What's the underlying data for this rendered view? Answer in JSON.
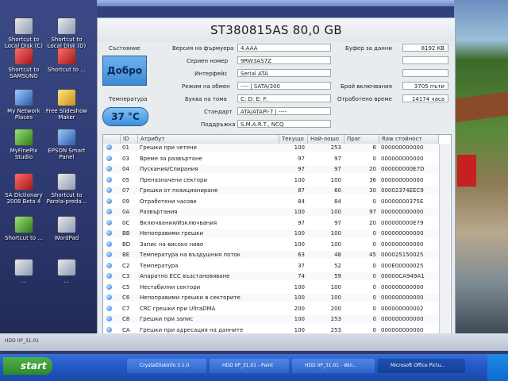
{
  "window": {
    "title": "ST380815AS 80,0 GB"
  },
  "status": {
    "label": "Състояние",
    "value": "Добро"
  },
  "temperature": {
    "label": "Температура",
    "value": "37 °C"
  },
  "info": {
    "firmware_label": "Версия на фърмуера",
    "firmware": "4.AAA",
    "serial_label": "Сериен номер",
    "serial": "9RW3AS7Z",
    "interface_label": "Интерфейс",
    "interface": "Serial ATA",
    "transfer_label": "Режим на обмен",
    "transfer": "---- | SATA/300",
    "volume_label": "Буква на тома",
    "volume": "C: D: E: F:",
    "standard_label": "Стандарт",
    "standard": "ATA/ATAPI-7 | ----",
    "features_label": "Поддръжка",
    "features": "S.M.A.R.T., NCQ",
    "buffer_label": "Буфер за данни",
    "buffer": "8192 KB",
    "power_count_label": "Брой включвания",
    "power_count": "3705 пъти",
    "power_hours_label": "Отработено време",
    "power_hours": "14174 часа"
  },
  "table": {
    "headers": [
      "ID",
      "Атрибут",
      "Текущо",
      "Най-лошо",
      "Праг",
      "Raw стойност"
    ],
    "rows": [
      {
        "id": "01",
        "name": "Грешки при четене",
        "cur": "100",
        "worst": "253",
        "thr": "6",
        "raw": "000000000000"
      },
      {
        "id": "03",
        "name": "Време за развъртане",
        "cur": "97",
        "worst": "97",
        "thr": "0",
        "raw": "000000000000"
      },
      {
        "id": "04",
        "name": "Пускания/Спирания",
        "cur": "97",
        "worst": "97",
        "thr": "20",
        "raw": "000000000E7D"
      },
      {
        "id": "05",
        "name": "Преназначени сектори",
        "cur": "100",
        "worst": "100",
        "thr": "36",
        "raw": "000000000000"
      },
      {
        "id": "07",
        "name": "Грешки от позициониране",
        "cur": "87",
        "worst": "60",
        "thr": "30",
        "raw": "00002374EEC9"
      },
      {
        "id": "09",
        "name": "Отработени часове",
        "cur": "84",
        "worst": "84",
        "thr": "0",
        "raw": "00000000375E"
      },
      {
        "id": "0A",
        "name": "Развъртания",
        "cur": "100",
        "worst": "100",
        "thr": "97",
        "raw": "000000000000"
      },
      {
        "id": "0C",
        "name": "Включвания/Изключвания",
        "cur": "97",
        "worst": "97",
        "thr": "20",
        "raw": "000000000E79"
      },
      {
        "id": "BB",
        "name": "Непоправими грешки",
        "cur": "100",
        "worst": "100",
        "thr": "0",
        "raw": "000000000000"
      },
      {
        "id": "BD",
        "name": "Запис на високо ниво",
        "cur": "100",
        "worst": "100",
        "thr": "0",
        "raw": "000000000000"
      },
      {
        "id": "BE",
        "name": "Температура на въздушния поток",
        "cur": "63",
        "worst": "48",
        "thr": "45",
        "raw": "000025150025"
      },
      {
        "id": "C2",
        "name": "Температура",
        "cur": "37",
        "worst": "52",
        "thr": "0",
        "raw": "000E00000025"
      },
      {
        "id": "C3",
        "name": "Апаратно ECC възстановяване",
        "cur": "74",
        "worst": "59",
        "thr": "0",
        "raw": "00000CA949A1"
      },
      {
        "id": "C5",
        "name": "Нестабилни сектори",
        "cur": "100",
        "worst": "100",
        "thr": "0",
        "raw": "000000000000"
      },
      {
        "id": "C6",
        "name": "Непоправими грешки в секторите",
        "cur": "100",
        "worst": "100",
        "thr": "0",
        "raw": "000000000000"
      },
      {
        "id": "C7",
        "name": "CRC грешки при UltraDMA",
        "cur": "200",
        "worst": "200",
        "thr": "0",
        "raw": "000000000002"
      },
      {
        "id": "C8",
        "name": "Грешки при запис",
        "cur": "100",
        "worst": "253",
        "thr": "0",
        "raw": "000000000000"
      },
      {
        "id": "CA",
        "name": "Грешки при адресация на данните",
        "cur": "100",
        "worst": "253",
        "thr": "0",
        "raw": "000000000000"
      }
    ]
  },
  "desktop": {
    "icons": [
      {
        "label": "Shortcut to Local Disk (C)"
      },
      {
        "label": "Shortcut to Local Disk (D)"
      },
      {
        "label": "Shortcut to SAMSUNG"
      },
      {
        "label": "Shortcut to ..."
      },
      {
        "label": "My Network Places"
      },
      {
        "label": "Free Slideshow Maker"
      },
      {
        "label": "MyFinePix Studio"
      },
      {
        "label": "EPSON Smart Panel"
      },
      {
        "label": "SA Dictionary 2008 Beta 4"
      },
      {
        "label": "Shortcut to Parola-preda..."
      },
      {
        "label": "Shortcut to ..."
      },
      {
        "label": "WordPad"
      },
      {
        "label": "..."
      },
      {
        "label": "..."
      }
    ]
  },
  "bottom": {
    "left": "HDD IIP_31.01"
  },
  "taskbar": {
    "start": "start",
    "buttons": [
      {
        "label": "CrystalDiskInfo 3.1.0"
      },
      {
        "label": "HDD IIP_31.01 - Paint"
      },
      {
        "label": "HDD IIP_31.01 - Win..."
      },
      {
        "label": "Microsoft Office Pictu..."
      }
    ]
  }
}
